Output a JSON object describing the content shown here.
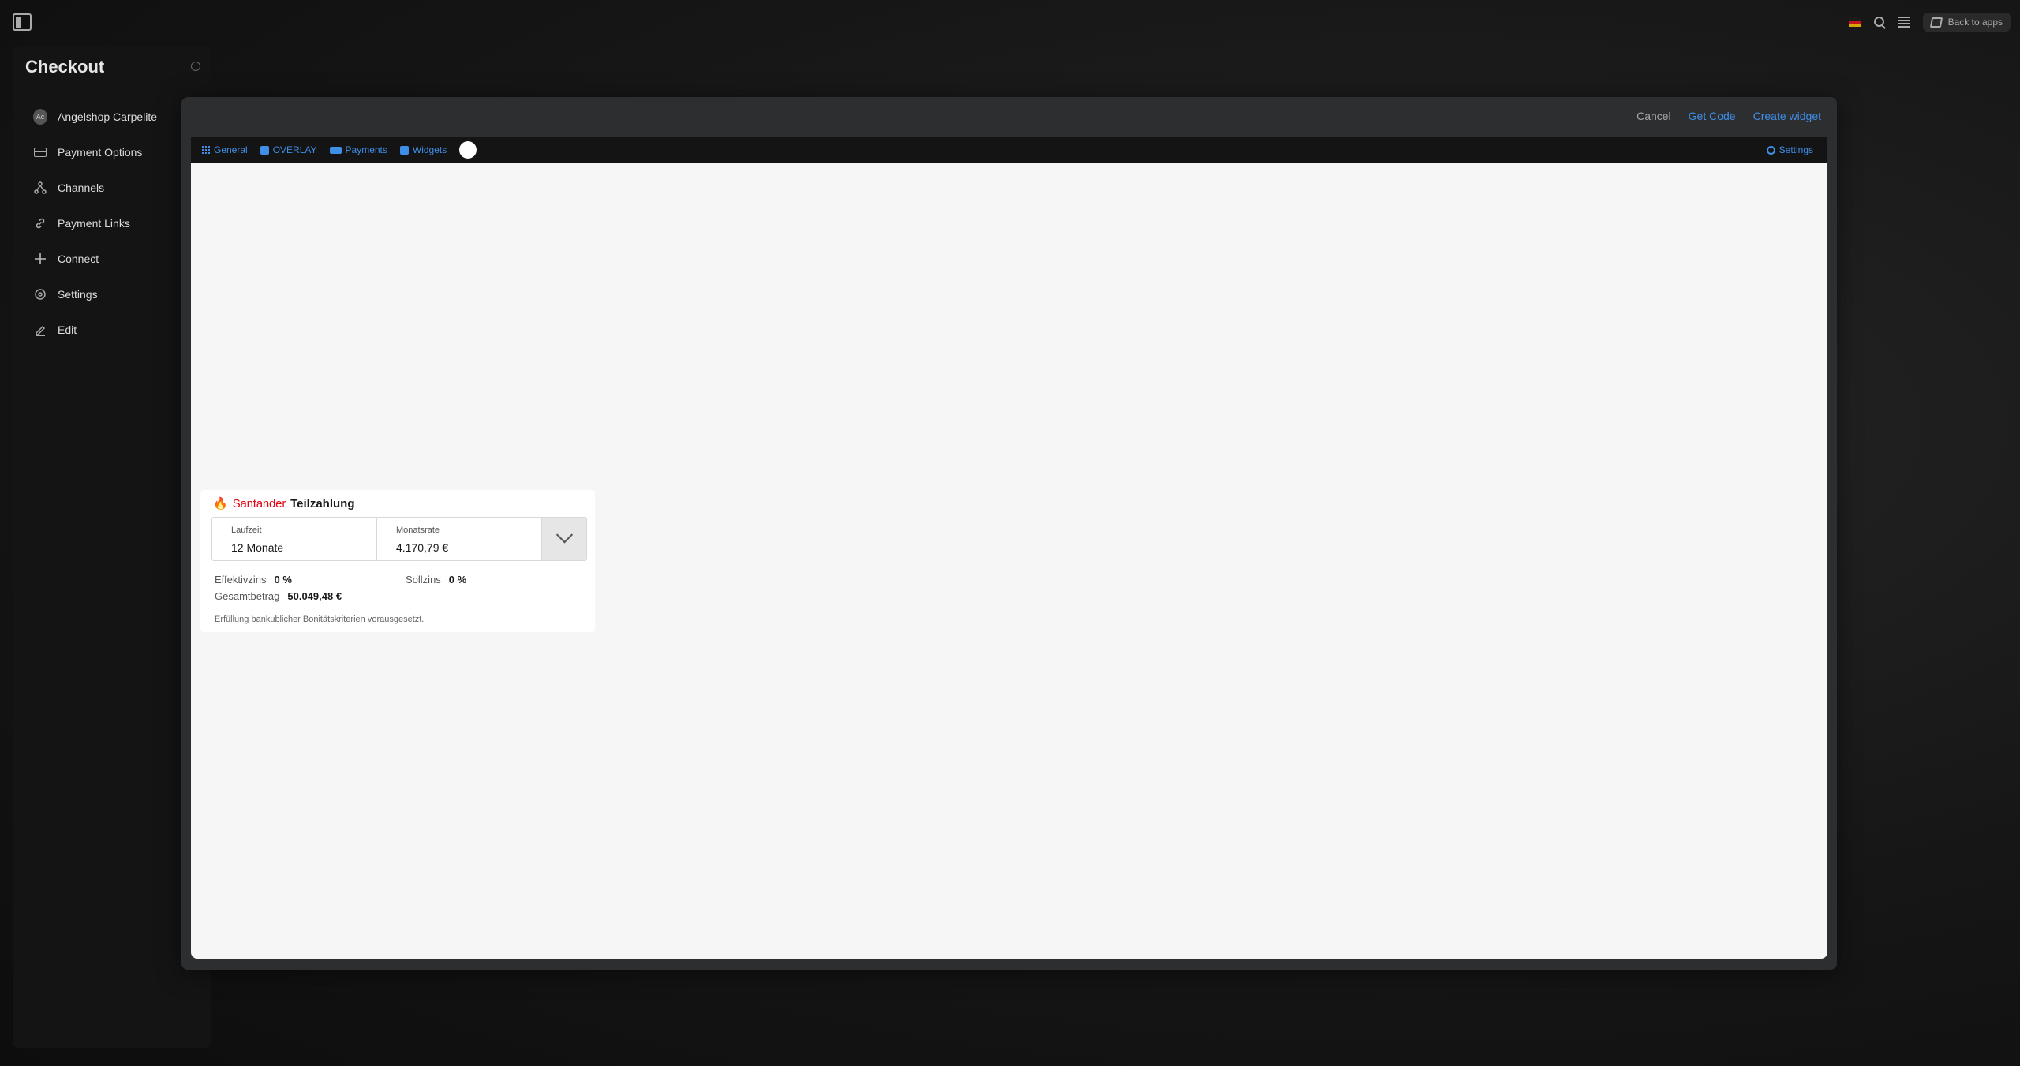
{
  "topbar": {
    "back_label": "Back to apps",
    "icons": [
      "sidebar-toggle-icon",
      "flag-icon",
      "search-icon",
      "menu-icon",
      "layers-icon"
    ]
  },
  "sidebar": {
    "title": "Checkout",
    "avatar_initials": "Ac",
    "items": [
      {
        "label": "Angelshop Carpelite",
        "icon": "avatar"
      },
      {
        "label": "Payment Options",
        "icon": "card-icon"
      },
      {
        "label": "Channels",
        "icon": "channels-icon"
      },
      {
        "label": "Payment Links",
        "icon": "link-icon"
      },
      {
        "label": "Connect",
        "icon": "plus-icon"
      },
      {
        "label": "Settings",
        "icon": "gear-icon"
      },
      {
        "label": "Edit",
        "icon": "pencil-icon"
      }
    ]
  },
  "modal": {
    "cancel": "Cancel",
    "get_code": "Get Code",
    "create_widget": "Create widget",
    "tabs": [
      {
        "label": "General",
        "icon": "grid-icon"
      },
      {
        "label": "OVERLAY",
        "icon": "overlay-icon"
      },
      {
        "label": "Payments",
        "icon": "payments-icon"
      },
      {
        "label": "Widgets",
        "icon": "widgets-icon"
      }
    ],
    "settings": "Settings"
  },
  "widget": {
    "brand": "Santander",
    "product": "Teilzahlung",
    "term_label": "Laufzeit",
    "term_value": "12 Monate",
    "rate_label": "Monatsrate",
    "rate_value": "4.170,79 €",
    "eff_label": "Effektivzins",
    "eff_value": "0 %",
    "soll_label": "Sollzins",
    "soll_value": "0 %",
    "total_label": "Gesamtbetrag",
    "total_value": "50.049,48 €",
    "note": "Erfüllung bankublicher Bonitätskriterien vorausgesetzt."
  },
  "colors": {
    "accent": "#3f8ee8",
    "brand_red": "#e30613",
    "canvas": "#f6f6f6",
    "modal": "#2d2e30"
  }
}
